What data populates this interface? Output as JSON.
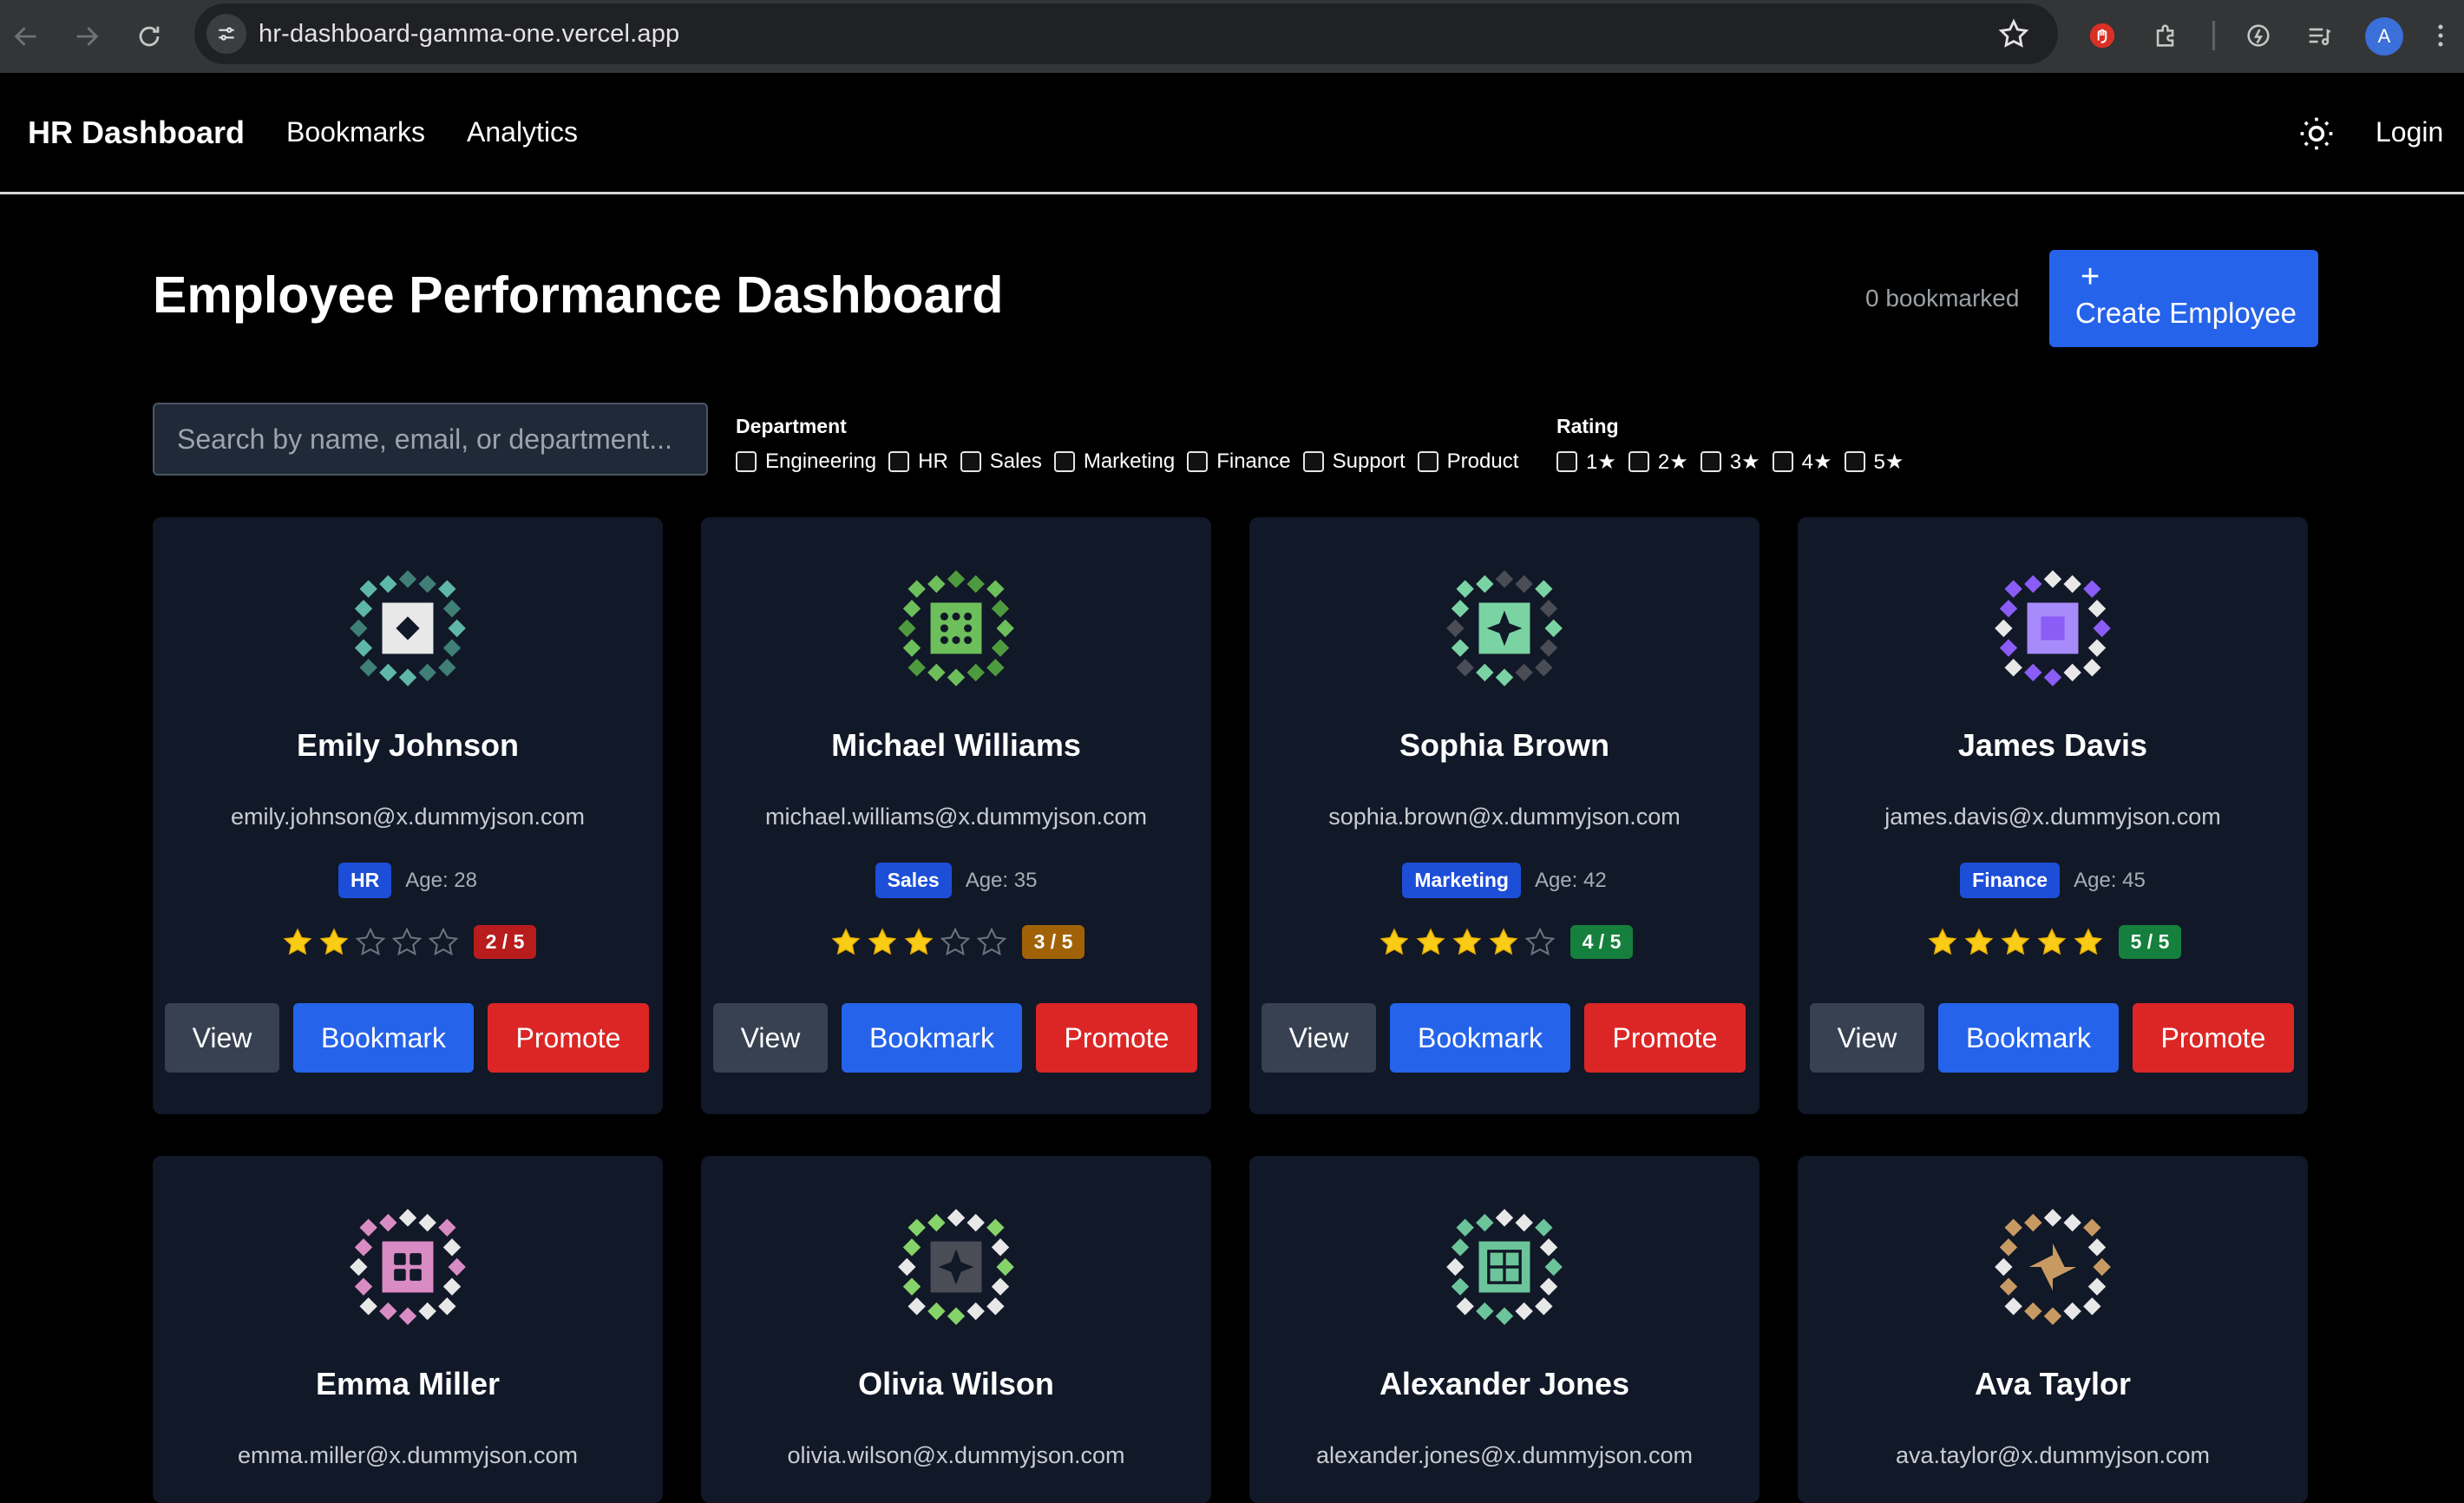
{
  "browser": {
    "url": "hr-dashboard-gamma-one.vercel.app",
    "profile_initial": "A"
  },
  "header": {
    "brand": "HR Dashboard",
    "nav": [
      "Bookmarks",
      "Analytics"
    ],
    "login": "Login"
  },
  "page": {
    "title": "Employee Performance Dashboard",
    "bookmarked_count": "0 bookmarked",
    "create_button": "Create Employee",
    "create_icon": "+"
  },
  "search": {
    "placeholder": "Search by name, email, or department..."
  },
  "filters": {
    "department_label": "Department",
    "departments": [
      "Engineering",
      "HR",
      "Sales",
      "Marketing",
      "Finance",
      "Support",
      "Product"
    ],
    "rating_label": "Rating",
    "ratings": [
      "1★",
      "2★",
      "3★",
      "4★",
      "5★"
    ]
  },
  "buttons": {
    "view": "View",
    "bookmark": "Bookmark",
    "promote": "Promote"
  },
  "colors": {
    "accent": "#2563eb",
    "danger": "#dc2626",
    "card_bg": "#111827",
    "rating_low": "#b91c1c",
    "rating_mid": "#a16207",
    "rating_high": "#15803d",
    "star": "#facc15"
  },
  "employees": [
    {
      "name": "Emily Johnson",
      "email": "emily.johnson@x.dummyjson.com",
      "department": "HR",
      "age": "Age: 28",
      "rating": 2,
      "rating_label": "2 / 5",
      "rating_color": "#b91c1c",
      "avatar_icon": "identicon-teal"
    },
    {
      "name": "Michael Williams",
      "email": "michael.williams@x.dummyjson.com",
      "department": "Sales",
      "age": "Age: 35",
      "rating": 3,
      "rating_label": "3 / 5",
      "rating_color": "#a16207",
      "avatar_icon": "identicon-green"
    },
    {
      "name": "Sophia Brown",
      "email": "sophia.brown@x.dummyjson.com",
      "department": "Marketing",
      "age": "Age: 42",
      "rating": 4,
      "rating_label": "4 / 5",
      "rating_color": "#15803d",
      "avatar_icon": "identicon-mint"
    },
    {
      "name": "James Davis",
      "email": "james.davis@x.dummyjson.com",
      "department": "Finance",
      "age": "Age: 45",
      "rating": 5,
      "rating_label": "5 / 5",
      "rating_color": "#15803d",
      "avatar_icon": "identicon-purple"
    },
    {
      "name": "Emma Miller",
      "email": "emma.miller@x.dummyjson.com",
      "avatar_icon": "identicon-pink"
    },
    {
      "name": "Olivia Wilson",
      "email": "olivia.wilson@x.dummyjson.com",
      "avatar_icon": "identicon-lime"
    },
    {
      "name": "Alexander Jones",
      "email": "alexander.jones@x.dummyjson.com",
      "avatar_icon": "identicon-seafoam"
    },
    {
      "name": "Ava Taylor",
      "email": "ava.taylor@x.dummyjson.com",
      "avatar_icon": "identicon-tan"
    }
  ]
}
